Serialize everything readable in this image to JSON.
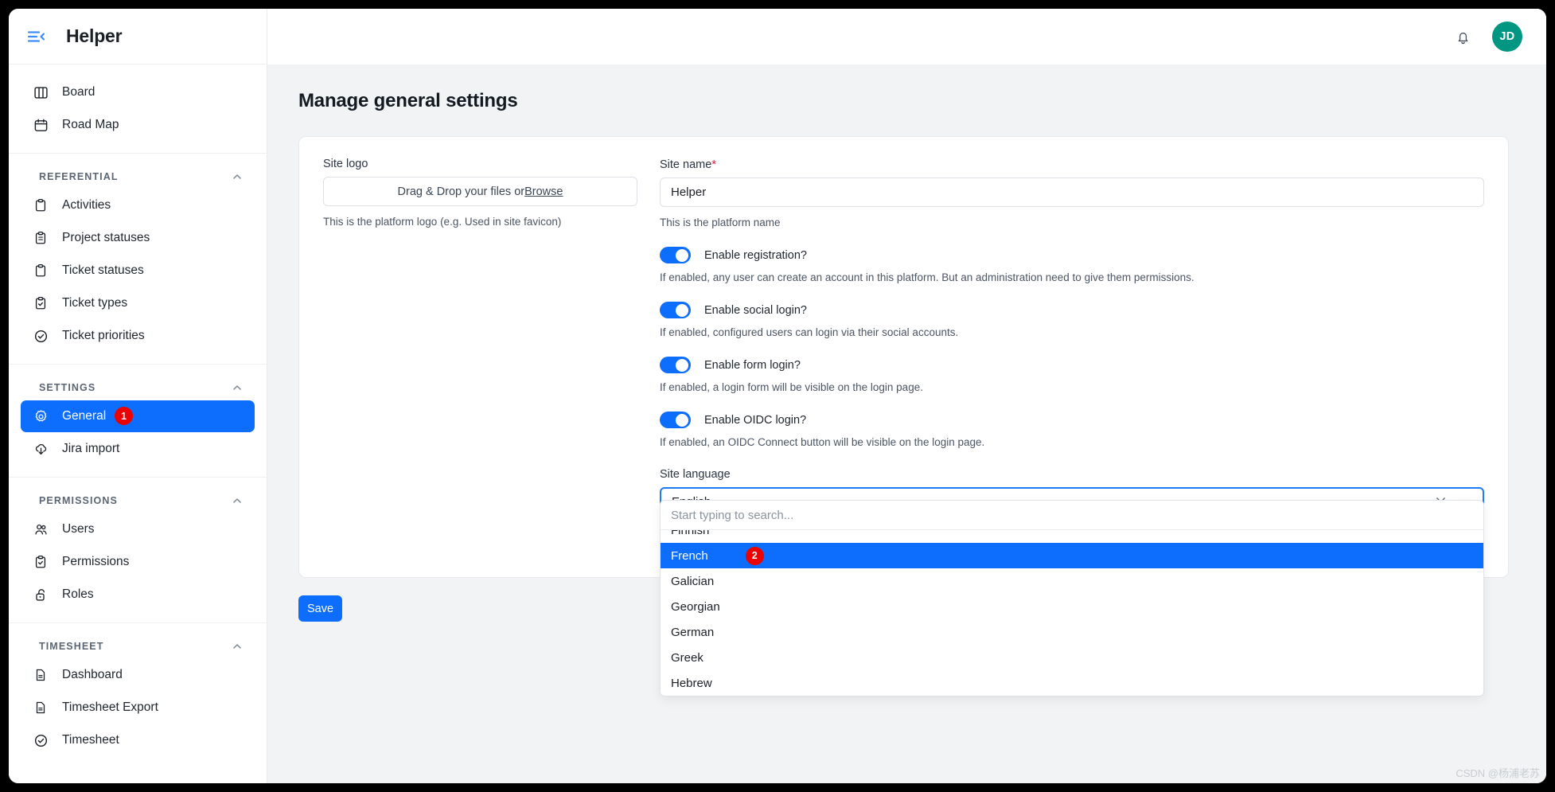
{
  "app": {
    "title": "Helper",
    "menu_icon": "hamburger-collapse-icon"
  },
  "topbar": {
    "notification_icon": "bell-icon",
    "avatar_initials": "JD",
    "avatar_color": "#009681"
  },
  "sidebar": {
    "top_items": [
      {
        "label": "Board",
        "icon": "columns-icon"
      },
      {
        "label": "Road Map",
        "icon": "calendar-icon"
      }
    ],
    "groups": [
      {
        "title": "REFERENTIAL",
        "collapse_icon": "chevron-up-icon",
        "items": [
          {
            "label": "Activities",
            "icon": "clipboard-icon"
          },
          {
            "label": "Project statuses",
            "icon": "clipboard-list-icon"
          },
          {
            "label": "Ticket statuses",
            "icon": "clipboard-icon"
          },
          {
            "label": "Ticket types",
            "icon": "clipboard-check-icon"
          },
          {
            "label": "Ticket priorities",
            "icon": "badge-check-icon"
          }
        ]
      },
      {
        "title": "SETTINGS",
        "collapse_icon": "chevron-up-icon",
        "items": [
          {
            "label": "General",
            "icon": "gear-icon",
            "active": true,
            "badge": "1"
          },
          {
            "label": "Jira import",
            "icon": "cloud-download-icon"
          }
        ]
      },
      {
        "title": "PERMISSIONS",
        "collapse_icon": "chevron-up-icon",
        "items": [
          {
            "label": "Users",
            "icon": "users-icon"
          },
          {
            "label": "Permissions",
            "icon": "clipboard-check-icon"
          },
          {
            "label": "Roles",
            "icon": "unlock-icon"
          }
        ]
      },
      {
        "title": "TIMESHEET",
        "collapse_icon": "chevron-up-icon",
        "items": [
          {
            "label": "Dashboard",
            "icon": "document-icon"
          },
          {
            "label": "Timesheet Export",
            "icon": "document-icon"
          },
          {
            "label": "Timesheet",
            "icon": "badge-check-icon"
          }
        ]
      }
    ]
  },
  "main": {
    "page_title": "Manage general settings",
    "site_logo": {
      "label": "Site logo",
      "dropzone_text": "Drag & Drop your files or ",
      "dropzone_link": "Browse",
      "hint": "This is the platform logo (e.g. Used in site favicon)"
    },
    "site_name": {
      "label": "Site name",
      "required_mark": "*",
      "value": "Helper",
      "hint": "This is the platform name"
    },
    "toggles": [
      {
        "label": "Enable registration?",
        "hint": "If enabled, any user can create an account in this platform. But an administration need to give them permissions.",
        "on": true
      },
      {
        "label": "Enable social login?",
        "hint": "If enabled, configured users can login via their social accounts.",
        "on": true
      },
      {
        "label": "Enable form login?",
        "hint": "If enabled, a login form will be visible on the login page.",
        "on": true
      },
      {
        "label": "Enable OIDC login?",
        "hint": "If enabled, an OIDC Connect button will be visible on the login page.",
        "on": true
      }
    ],
    "site_language": {
      "label": "Site language",
      "selected": "English",
      "clear_icon": "close-x-icon",
      "chevron_icon": "chevron-down-icon",
      "search_placeholder": "Start typing to search...",
      "options": [
        {
          "label": "Finnish",
          "clipped": true
        },
        {
          "label": "French",
          "selected": true,
          "badge": "2"
        },
        {
          "label": "Galician"
        },
        {
          "label": "Georgian"
        },
        {
          "label": "German"
        },
        {
          "label": "Greek"
        },
        {
          "label": "Hebrew",
          "clipped_bottom": true
        }
      ]
    },
    "save_button": "Save"
  },
  "watermark": "CSDN @杨浦老苏",
  "colors": {
    "accent": "#0d6efd",
    "badge": "#ec0000",
    "avatar": "#009681",
    "focus_border": "#1d7bf7"
  }
}
